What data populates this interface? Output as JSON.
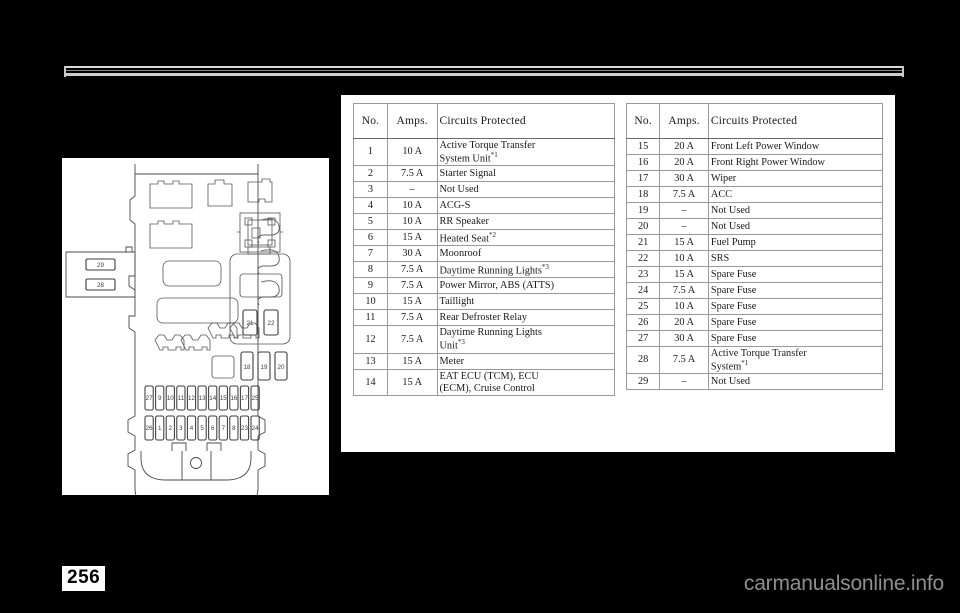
{
  "page": {
    "number": "256",
    "watermark": "carmanualsonline.info"
  },
  "tables": {
    "headers": {
      "no": "No.",
      "amps": "Amps.",
      "circuits": "Circuits Protected"
    },
    "left_rows": [
      {
        "no": "1",
        "amps": "10 A",
        "circuit": "Active Torque Transfer",
        "circuit2": "System Unit",
        "fn": "*1"
      },
      {
        "no": "2",
        "amps": "7.5 A",
        "circuit": "Starter Signal"
      },
      {
        "no": "3",
        "amps": "–",
        "circuit": "Not Used"
      },
      {
        "no": "4",
        "amps": "10 A",
        "circuit": "ACG-S"
      },
      {
        "no": "5",
        "amps": "10 A",
        "circuit": "RR Speaker"
      },
      {
        "no": "6",
        "amps": "15 A",
        "circuit": "Heated Seat",
        "fn": "*2"
      },
      {
        "no": "7",
        "amps": "30 A",
        "circuit": "Moonroof"
      },
      {
        "no": "8",
        "amps": "7.5 A",
        "circuit": "Daytime Running Lights",
        "fn": "*3"
      },
      {
        "no": "9",
        "amps": "7.5 A",
        "circuit": "Power Mirror, ABS (ATTS)"
      },
      {
        "no": "10",
        "amps": "15 A",
        "circuit": "Taillight"
      },
      {
        "no": "11",
        "amps": "7.5 A",
        "circuit": "Rear Defroster Relay"
      },
      {
        "no": "12",
        "amps": "7.5 A",
        "circuit": "Daytime Running Lights",
        "circuit2": "Unit",
        "fn": "*3"
      },
      {
        "no": "13",
        "amps": "15 A",
        "circuit": "Meter"
      },
      {
        "no": "14",
        "amps": "15 A",
        "circuit": "EAT ECU (TCM), ECU",
        "circuit2": "(ECM), Cruise Control"
      }
    ],
    "right_rows": [
      {
        "no": "15",
        "amps": "20 A",
        "circuit": "Front Left Power Window"
      },
      {
        "no": "16",
        "amps": "20 A",
        "circuit": "Front Right Power Window"
      },
      {
        "no": "17",
        "amps": "30 A",
        "circuit": "Wiper"
      },
      {
        "no": "18",
        "amps": "7.5 A",
        "circuit": "ACC"
      },
      {
        "no": "19",
        "amps": "–",
        "circuit": "Not Used"
      },
      {
        "no": "20",
        "amps": "–",
        "circuit": "Not Used"
      },
      {
        "no": "21",
        "amps": "15 A",
        "circuit": "Fuel Pump"
      },
      {
        "no": "22",
        "amps": "10 A",
        "circuit": "SRS"
      },
      {
        "no": "23",
        "amps": "15 A",
        "circuit": "Spare Fuse"
      },
      {
        "no": "24",
        "amps": "7.5 A",
        "circuit": "Spare Fuse"
      },
      {
        "no": "25",
        "amps": "10 A",
        "circuit": "Spare Fuse"
      },
      {
        "no": "26",
        "amps": "20 A",
        "circuit": "Spare Fuse"
      },
      {
        "no": "27",
        "amps": "30 A",
        "circuit": "Spare Fuse"
      },
      {
        "no": "28",
        "amps": "7.5 A",
        "circuit": "Active Torque Transfer",
        "circuit2": "System",
        "fn": "*1"
      },
      {
        "no": "29",
        "amps": "–",
        "circuit": "Not Used"
      }
    ]
  },
  "fuse_box_diagram": {
    "side_box_labels": [
      "29",
      "28"
    ],
    "upper_pair_labels": [
      "21",
      "22"
    ],
    "small_trio_labels": [
      "18",
      "19",
      "20"
    ],
    "grid_top_row": [
      "27",
      "9",
      "10",
      "11",
      "12",
      "13",
      "14",
      "15",
      "16",
      "17",
      "25"
    ],
    "grid_bottom_row": [
      "26",
      "1",
      "2",
      "3",
      "4",
      "5",
      "6",
      "7",
      "8",
      "23",
      "24"
    ]
  }
}
